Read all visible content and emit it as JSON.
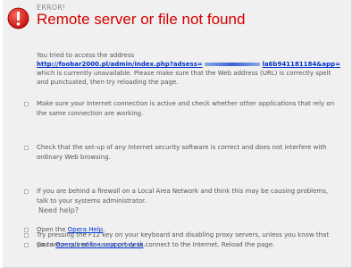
{
  "error_label": "ERROR!",
  "title": "Remote server or file not found",
  "intro": {
    "line1": "You tried to access the address",
    "url_prefix": "http://foobar2000.pl/admin/index.php?adsess=",
    "url_suffix": "la6b941181184&app=",
    "rest": "which is currently unavailable. Please make sure that the Web address (URL) is correctly spelt and punctuated, then try reloading the page."
  },
  "suggestions": [
    "Make sure your Internet connection is active and check whether other applications that rely on the same connection are working.",
    "Check that the set-up of any Internet security software is correct and does not interfere with ordinary Web browsing.",
    "If you are behind a firewall on a Local Area Network and think this may be causing problems, talk to your systems administrator.",
    "Try pressing the F12 key on your keyboard and disabling proxy servers, unless you know that you are required to use a proxy to connect to the Internet. Reload the page."
  ],
  "help": {
    "heading": "Need help?",
    "open_prefix": "Open the ",
    "open_link": "Opera Help",
    "open_suffix": ".",
    "goto_prefix": "Go to ",
    "goto_link": "Opera's online support desk",
    "goto_suffix": "."
  },
  "colors": {
    "title": "#d50000",
    "link": "#0033cc",
    "icon": "#d42020"
  },
  "icons": {
    "error": "error-exclamation-icon",
    "bullet": "square-bullet-icon"
  }
}
